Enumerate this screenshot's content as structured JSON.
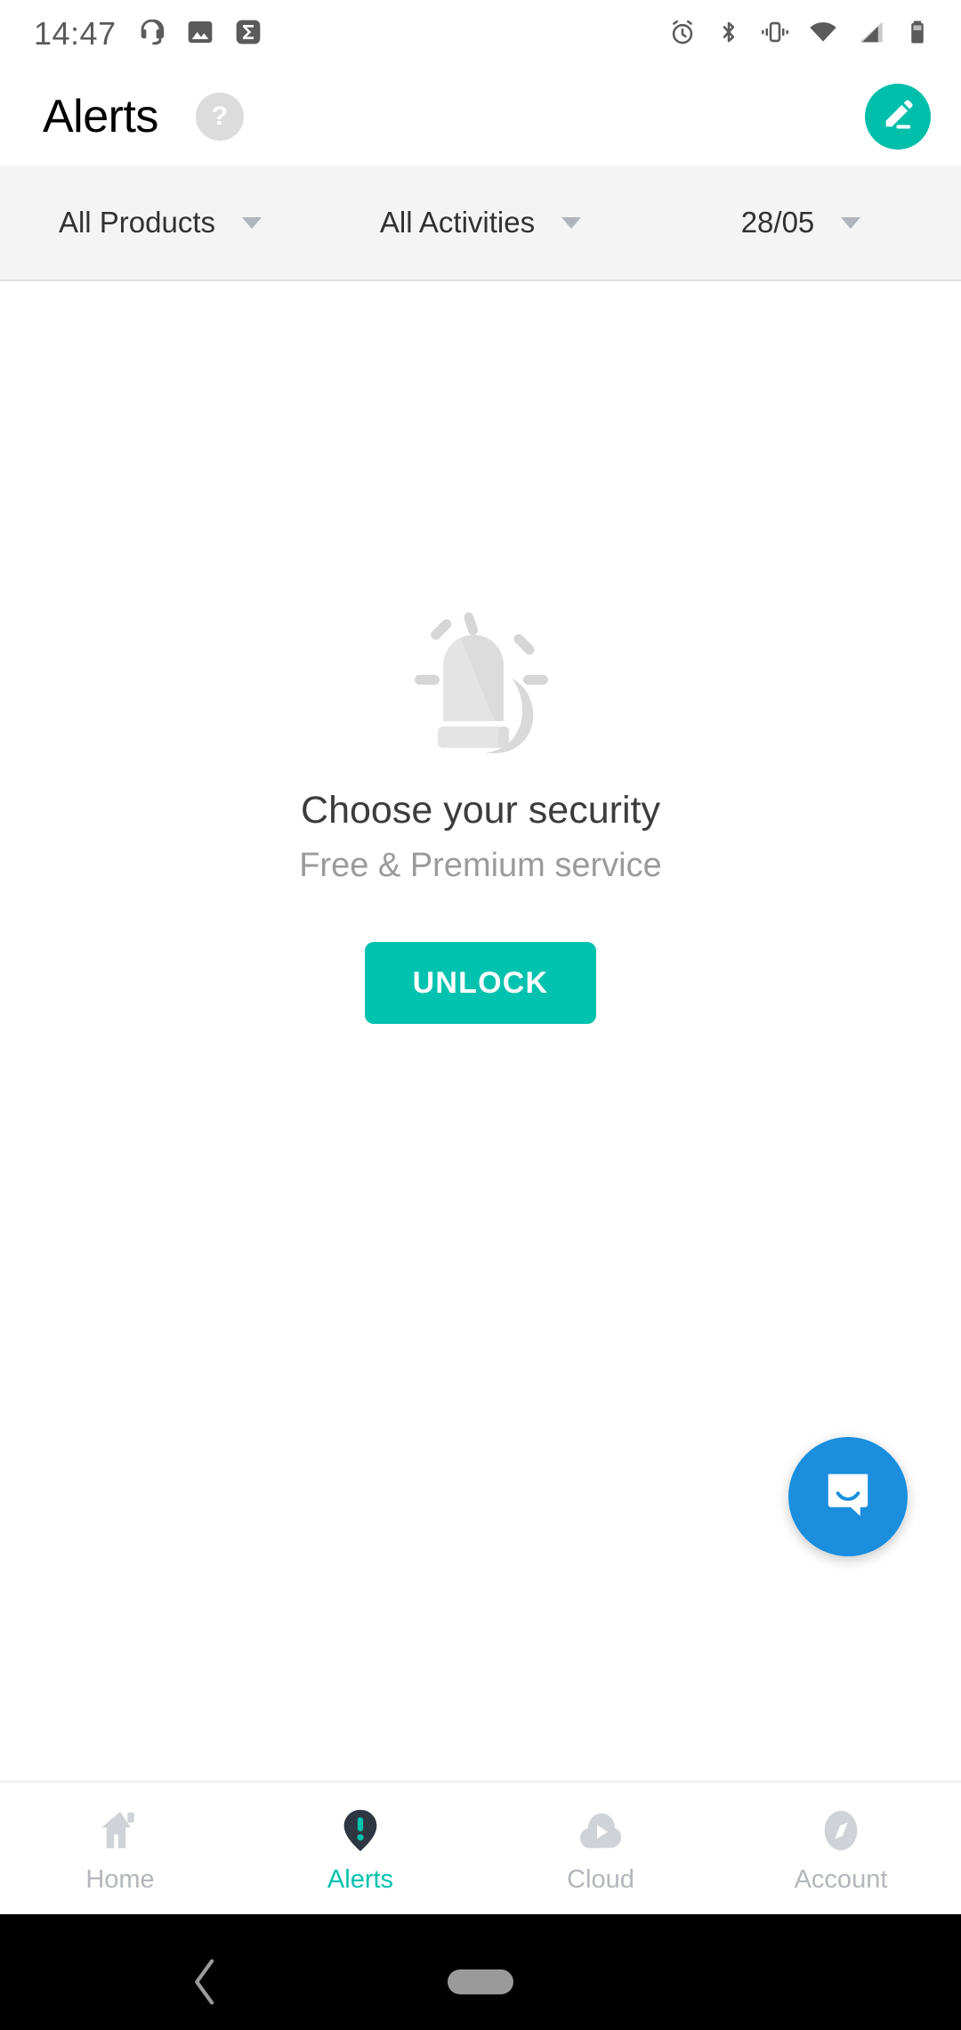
{
  "status_bar": {
    "time": "14:47",
    "left_icons": [
      "headset-icon",
      "image-icon",
      "sigma-icon"
    ],
    "right_icons": [
      "alarm-icon",
      "bluetooth-icon",
      "vibrate-icon",
      "wifi-icon",
      "cellular-signal-icon",
      "battery-icon"
    ]
  },
  "header": {
    "title": "Alerts",
    "help_label": "?",
    "edit_icon": "pencil-icon"
  },
  "filters": [
    {
      "label": "All Products",
      "name": "product-filter"
    },
    {
      "label": "All Activities",
      "name": "activity-filter"
    },
    {
      "label": "28/05",
      "name": "date-filter"
    }
  ],
  "empty_state": {
    "illustration": "alarm-siren-icon",
    "title": "Choose your security",
    "subtitle": "Free & Premium service",
    "cta_label": "UNLOCK"
  },
  "chat": {
    "icon": "chat-bubble-icon"
  },
  "bottom_nav": {
    "items": [
      {
        "label": "Home",
        "icon": "home-icon",
        "active": false
      },
      {
        "label": "Alerts",
        "icon": "alert-pin-icon",
        "active": true
      },
      {
        "label": "Cloud",
        "icon": "cloud-play-icon",
        "active": false
      },
      {
        "label": "Account",
        "icon": "compass-icon",
        "active": false
      }
    ]
  },
  "android_nav": {
    "back": "back-chevron-icon",
    "home": "home-pill-indicator"
  },
  "colors": {
    "accent_teal": "#00c2ae",
    "chat_blue": "#1b8ede",
    "filter_bg": "#f4f4f4",
    "nav_inactive": "#b3b6bb",
    "pin_navy": "#2e3641"
  }
}
